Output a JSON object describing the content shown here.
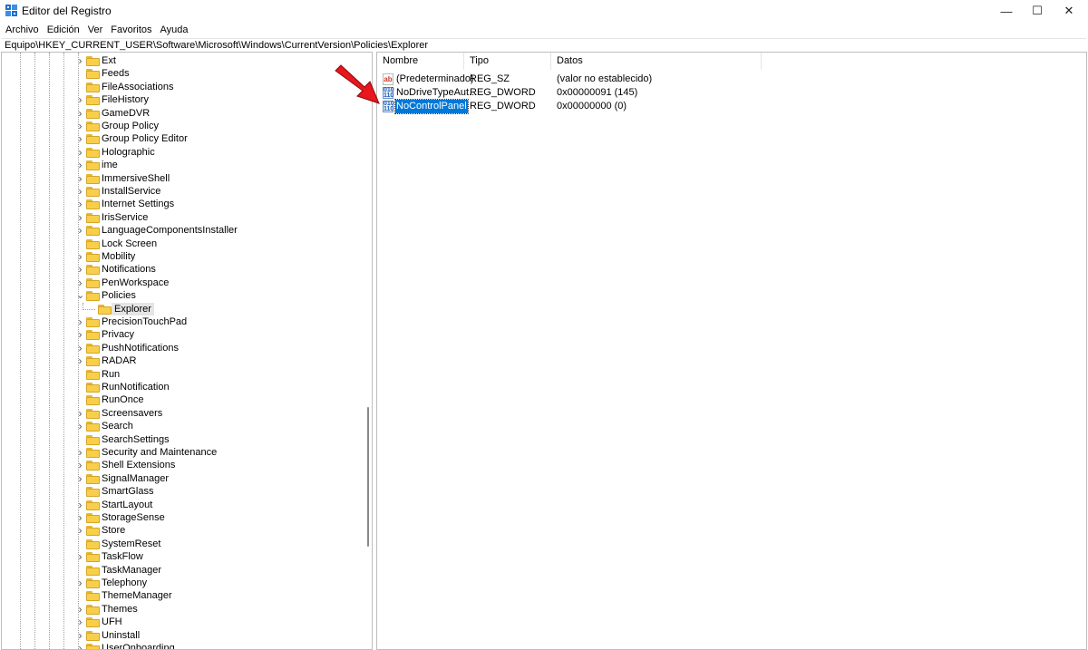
{
  "window": {
    "title": "Editor del Registro",
    "minimize_glyph": "—",
    "maximize_glyph": "☐",
    "close_glyph": "✕"
  },
  "menu": [
    "Archivo",
    "Edición",
    "Ver",
    "Favoritos",
    "Ayuda"
  ],
  "address": "Equipo\\HKEY_CURRENT_USER\\Software\\Microsoft\\Windows\\CurrentVersion\\Policies\\Explorer",
  "tree": {
    "items": [
      {
        "label": "Ext",
        "state": "collapsed"
      },
      {
        "label": "Feeds",
        "state": "leaf"
      },
      {
        "label": "FileAssociations",
        "state": "leaf"
      },
      {
        "label": "FileHistory",
        "state": "collapsed"
      },
      {
        "label": "GameDVR",
        "state": "collapsed"
      },
      {
        "label": "Group Policy",
        "state": "collapsed"
      },
      {
        "label": "Group Policy Editor",
        "state": "collapsed"
      },
      {
        "label": "Holographic",
        "state": "collapsed"
      },
      {
        "label": "ime",
        "state": "collapsed"
      },
      {
        "label": "ImmersiveShell",
        "state": "collapsed"
      },
      {
        "label": "InstallService",
        "state": "collapsed"
      },
      {
        "label": "Internet Settings",
        "state": "collapsed"
      },
      {
        "label": "IrisService",
        "state": "collapsed"
      },
      {
        "label": "LanguageComponentsInstaller",
        "state": "collapsed"
      },
      {
        "label": "Lock Screen",
        "state": "leaf"
      },
      {
        "label": "Mobility",
        "state": "collapsed"
      },
      {
        "label": "Notifications",
        "state": "collapsed"
      },
      {
        "label": "PenWorkspace",
        "state": "collapsed"
      },
      {
        "label": "Policies",
        "state": "expanded"
      },
      {
        "label": "Explorer",
        "state": "child-selected"
      },
      {
        "label": "PrecisionTouchPad",
        "state": "collapsed"
      },
      {
        "label": "Privacy",
        "state": "collapsed"
      },
      {
        "label": "PushNotifications",
        "state": "collapsed"
      },
      {
        "label": "RADAR",
        "state": "collapsed"
      },
      {
        "label": "Run",
        "state": "leaf"
      },
      {
        "label": "RunNotification",
        "state": "leaf"
      },
      {
        "label": "RunOnce",
        "state": "leaf"
      },
      {
        "label": "Screensavers",
        "state": "collapsed"
      },
      {
        "label": "Search",
        "state": "collapsed"
      },
      {
        "label": "SearchSettings",
        "state": "leaf"
      },
      {
        "label": "Security and Maintenance",
        "state": "collapsed"
      },
      {
        "label": "Shell Extensions",
        "state": "collapsed"
      },
      {
        "label": "SignalManager",
        "state": "collapsed"
      },
      {
        "label": "SmartGlass",
        "state": "leaf"
      },
      {
        "label": "StartLayout",
        "state": "collapsed"
      },
      {
        "label": "StorageSense",
        "state": "collapsed"
      },
      {
        "label": "Store",
        "state": "collapsed"
      },
      {
        "label": "SystemReset",
        "state": "leaf"
      },
      {
        "label": "TaskFlow",
        "state": "collapsed"
      },
      {
        "label": "TaskManager",
        "state": "leaf"
      },
      {
        "label": "Telephony",
        "state": "collapsed"
      },
      {
        "label": "ThemeManager",
        "state": "leaf"
      },
      {
        "label": "Themes",
        "state": "collapsed"
      },
      {
        "label": "UFH",
        "state": "collapsed"
      },
      {
        "label": "Uninstall",
        "state": "collapsed"
      },
      {
        "label": "UserOnboarding",
        "state": "collapsed"
      }
    ]
  },
  "list": {
    "columns": [
      "Nombre",
      "Tipo",
      "Datos"
    ],
    "rows": [
      {
        "icon": "string-value-icon",
        "icon_text": "ab",
        "name": "(Predeterminado)",
        "type": "REG_SZ",
        "data": "(valor no establecido)",
        "selected": false
      },
      {
        "icon": "dword-value-icon",
        "icon_text": "010 110",
        "name": "NoDriveTypeAut...",
        "type": "REG_DWORD",
        "data": "0x00000091 (145)",
        "selected": false
      },
      {
        "icon": "dword-value-icon",
        "icon_text": "010 110",
        "name": "NoControlPanel",
        "type": "REG_DWORD",
        "data": "0x00000000 (0)",
        "selected": true
      }
    ]
  },
  "annotation": {
    "icon": "red-arrow-icon",
    "color": "#e8161d"
  },
  "colors": {
    "selection": "#0078d7",
    "folder": "#f8cf4a",
    "tree_selected": "#e5e5e5"
  }
}
